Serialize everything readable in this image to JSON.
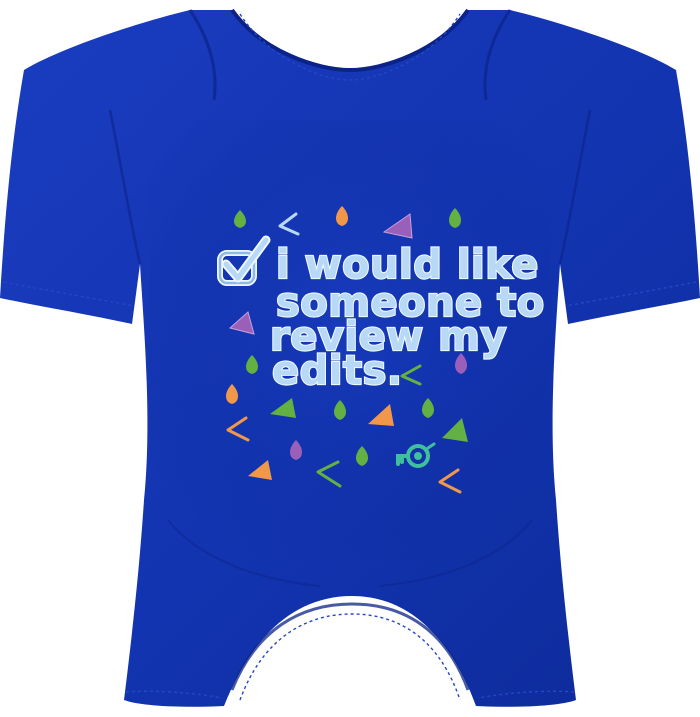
{
  "garment": {
    "type": "short-sleeve baby bodysuit",
    "fabric_color": "#1234b0",
    "fabric_shadow": "#0b2388",
    "fabric_highlight": "#1f45c8",
    "stitch_color": "#2447c4"
  },
  "print": {
    "checkbox_icon": "checked-box-icon",
    "lines": [
      "i would like",
      "someone to",
      "review my",
      "edits."
    ],
    "text_color": "#b7d9f5",
    "confetti_colors": {
      "green": "#63b043",
      "orange": "#f0974a",
      "purple": "#9a5fb8",
      "teal_key": "#3fbf9b"
    }
  }
}
